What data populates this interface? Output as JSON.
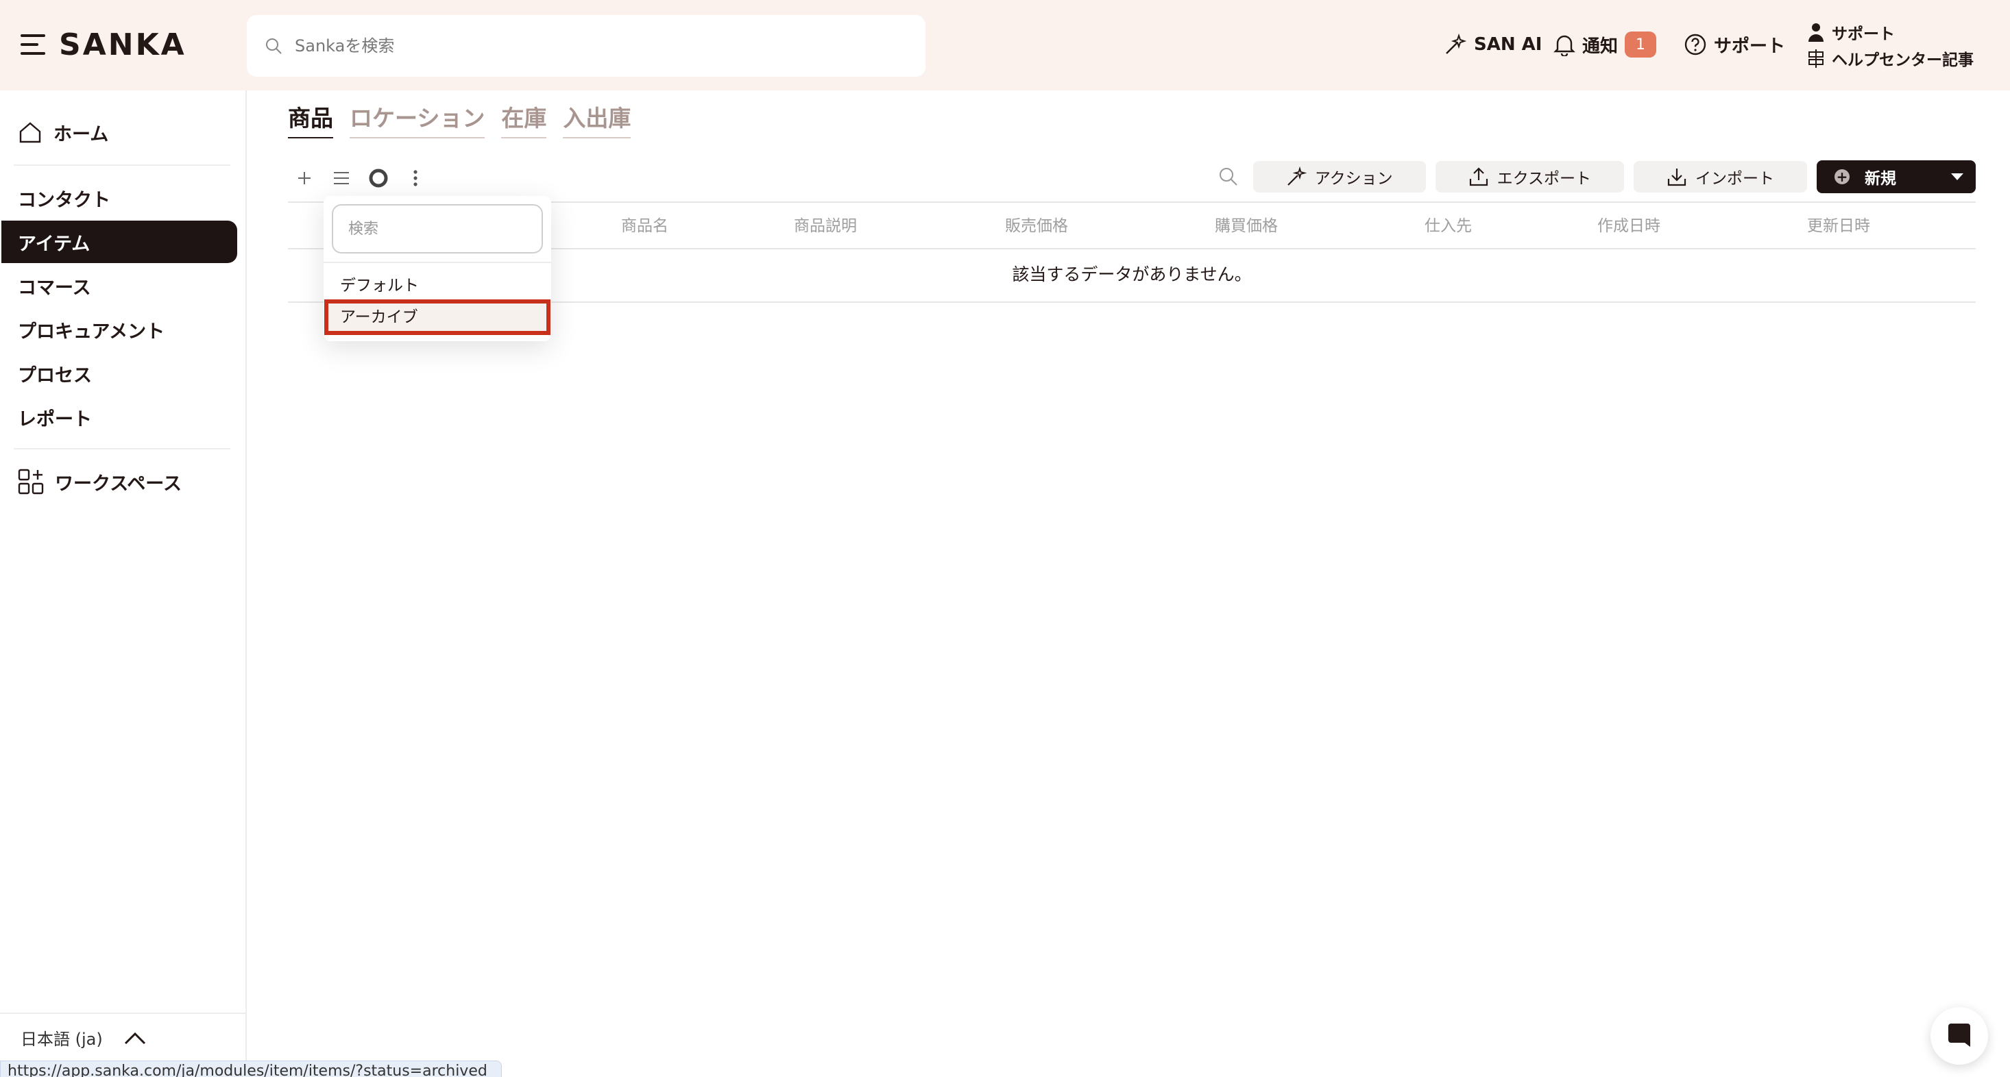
{
  "header": {
    "logo": "SANKA",
    "search_placeholder": "Sankaを検索",
    "san_ai": "SAN AI",
    "notifications": "通知",
    "notification_count": "1",
    "support": "サポート",
    "help_support": "サポート",
    "help_center": "ヘルプセンター記事"
  },
  "sidebar": {
    "home": "ホーム",
    "items": [
      {
        "label": "コンタクト",
        "active": false
      },
      {
        "label": "アイテム",
        "active": true
      },
      {
        "label": "コマース",
        "active": false
      },
      {
        "label": "プロキュアメント",
        "active": false
      },
      {
        "label": "プロセス",
        "active": false
      },
      {
        "label": "レポート",
        "active": false
      }
    ],
    "workspace": "ワークスペース",
    "language": "日本語 (ja)"
  },
  "tabs": [
    {
      "label": "商品",
      "active": true
    },
    {
      "label": "ロケーション",
      "active": false
    },
    {
      "label": "在庫",
      "active": false
    },
    {
      "label": "入出庫",
      "active": false
    }
  ],
  "toolbar": {
    "action": "アクション",
    "export": "エクスポート",
    "import": "インポート",
    "new": "新規"
  },
  "table": {
    "columns": [
      "商品名",
      "商品説明",
      "販売価格",
      "購買価格",
      "仕入先",
      "作成日時",
      "更新日時"
    ],
    "empty_message": "該当するデータがありません。"
  },
  "view_dropdown": {
    "search_placeholder": "検索",
    "options": [
      "デフォルト",
      "アーカイブ"
    ],
    "highlighted": "アーカイブ"
  },
  "status_bar_url": "https://app.sanka.com/ja/modules/item/items/?status=archived",
  "colors": {
    "header_bg": "#fbf1ed",
    "active_bg": "#1e1413",
    "badge": "#e4795c",
    "highlight_outline": "#c8301c"
  }
}
